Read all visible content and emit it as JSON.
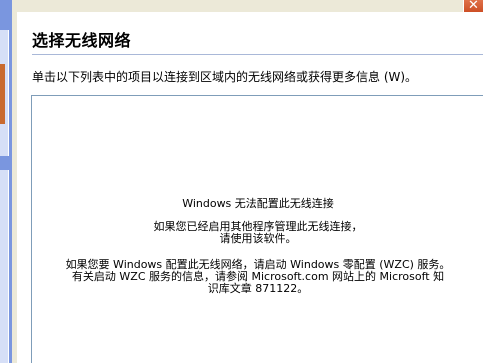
{
  "header": {
    "close_glyph": "✕"
  },
  "main": {
    "title": "选择无线网络",
    "instructions": "单击以下列表中的项目以连接到区域内的无线网络或获得更多信息 (W)。",
    "list_message": {
      "title": "Windows 无法配置此无线连接",
      "other_program_line1": "如果您已经启用其他程序管理此无线连接，",
      "other_program_line2": "请使用该软件。",
      "wzc_line1": "如果您要 Windows 配置此无线网络，请启动 Windows 零配置 (WZC) 服务。",
      "wzc_line2": "有关启动 WZC 服务的信息，请参阅 Microsoft.com 网站上的 Microsoft 知",
      "wzc_line3": "识库文章 871122。"
    }
  },
  "colors": {
    "window_frame": "#7a96df",
    "task_pane": "#d6dff7",
    "close_button": "#c8461d",
    "list_border": "#7f9db9"
  }
}
